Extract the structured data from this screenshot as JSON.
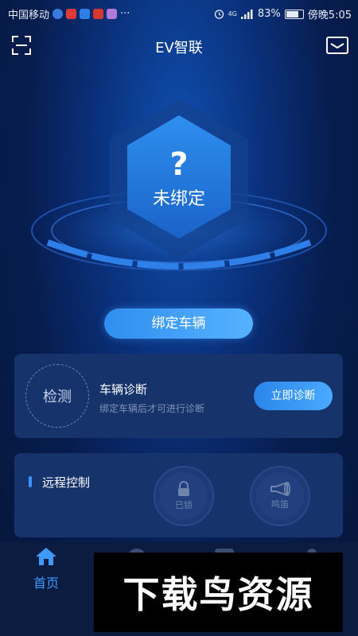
{
  "status_bar": {
    "carrier": "中国移动",
    "more": "···",
    "signal_label": "4G",
    "battery": "83%",
    "time": "傍晚5:05"
  },
  "header": {
    "title": "EV智联",
    "left_icon": "scan-icon",
    "right_icon": "mail-icon"
  },
  "hero": {
    "question_mark": "?",
    "status": "未绑定"
  },
  "bind_button": {
    "label": "绑定车辆"
  },
  "diagnosis_card": {
    "badge": "检测",
    "title": "车辆诊断",
    "subtitle": "绑定车辆后才可进行诊断",
    "button": "立即诊断"
  },
  "remote_card": {
    "title": "远程控制",
    "controls": [
      {
        "label": "已锁",
        "icon": "lock-icon"
      },
      {
        "label": "鸣笛",
        "icon": "horn-icon"
      }
    ]
  },
  "tabbar": {
    "items": [
      {
        "label": "首页",
        "icon": "home-icon"
      }
    ]
  },
  "watermark": {
    "text": "下载鸟资源"
  },
  "colors": {
    "accent": "#3d9bff",
    "card": "#17336b",
    "background": "#071d4f"
  }
}
